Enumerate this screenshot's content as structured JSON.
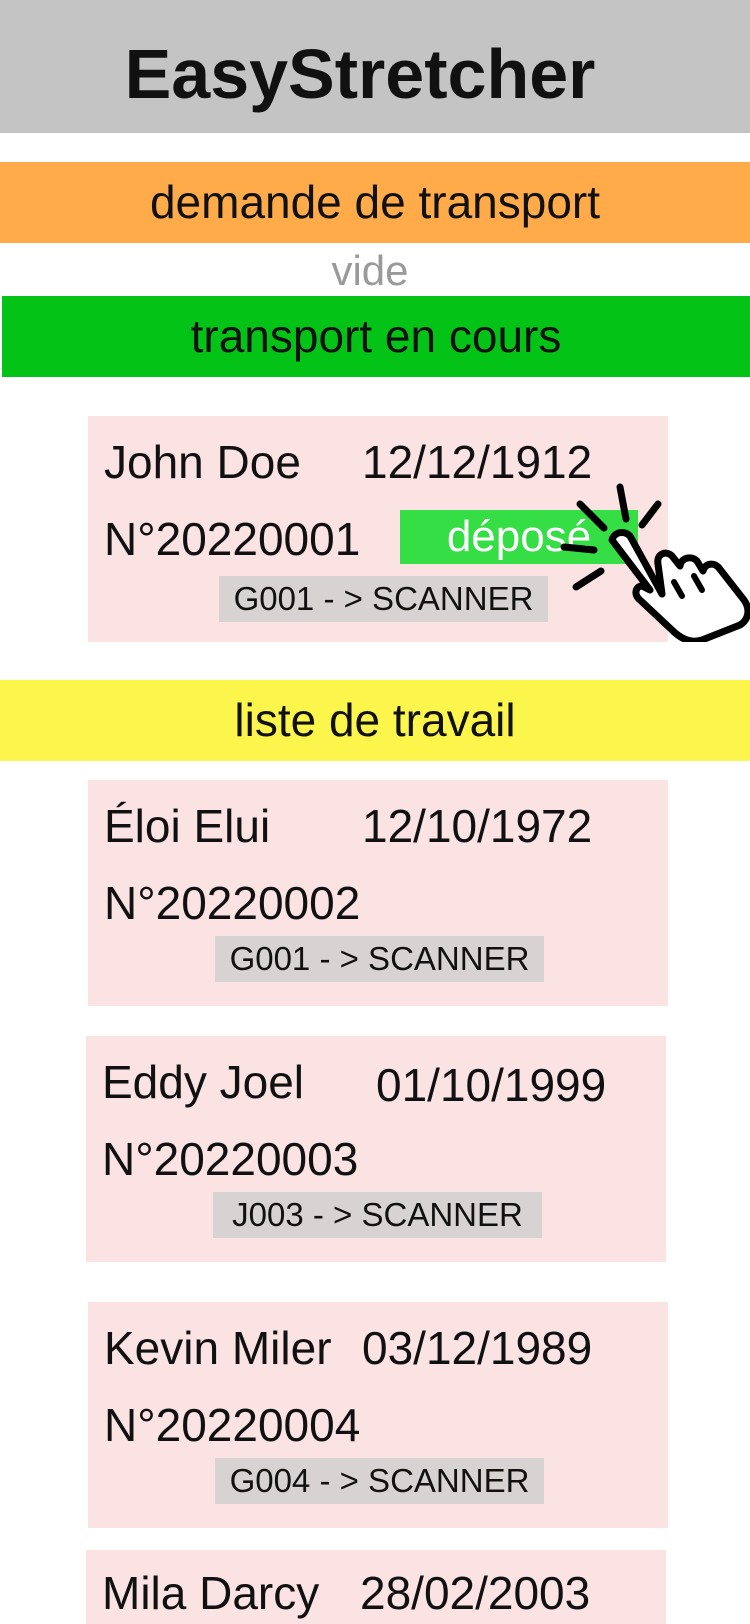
{
  "app": {
    "title": "EasyStretcher"
  },
  "sections": {
    "requests": {
      "label": "demande de transport",
      "empty_text": "vide"
    },
    "current": {
      "label": "transport en cours"
    },
    "worklist": {
      "label": "liste de travail"
    }
  },
  "current_transport": {
    "name": "John Doe",
    "dob": "12/12/1912",
    "number": "N°20220001",
    "route": "G001 - > SCANNER",
    "status_button": "déposé"
  },
  "worklist_items": [
    {
      "name": "Éloi Elui",
      "dob": "12/10/1972",
      "number": "N°20220002",
      "route": "G001 - > SCANNER"
    },
    {
      "name": "Eddy Joel",
      "dob": "01/10/1999",
      "number": "N°20220003",
      "route": "J003 - > SCANNER"
    },
    {
      "name": "Kevin Miler",
      "dob": "03/12/1989",
      "number": "N°20220004",
      "route": "G004 - > SCANNER"
    },
    {
      "name": "Mila Darcy",
      "dob": "28/02/2003"
    }
  ],
  "icons": {
    "tap_hint": "hand-tap-icon"
  },
  "colors": {
    "header": "#c4c4c4",
    "requests_bar": "#ffab4a",
    "current_bar": "#03c416",
    "worklist_bar": "#fcf64c",
    "card_background": "#fbe3e4",
    "status_button": "#35de45",
    "route_tag": "#d8d3d3"
  }
}
